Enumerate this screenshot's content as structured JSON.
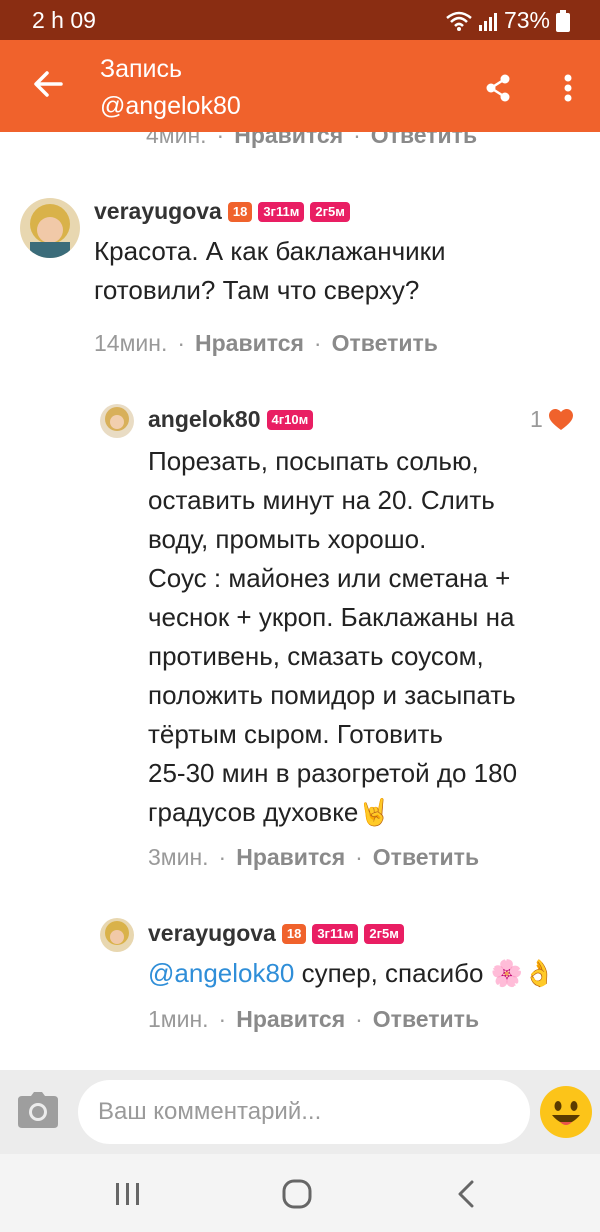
{
  "status_bar": {
    "time": "2 h 09",
    "battery": "73%"
  },
  "app_bar": {
    "title": "Запись",
    "subtitle": "@angelok80"
  },
  "comments": [
    {
      "partial": true,
      "time": "4мин.",
      "like_label": "Нравится",
      "reply_label": "Ответить"
    },
    {
      "username": "verayugova",
      "badges": [
        "18",
        "3г11м",
        "2г5м"
      ],
      "text": "Красота. А как баклажанчики готовили? Там что сверху?",
      "time": "14мин.",
      "like_label": "Нравится",
      "reply_label": "Ответить"
    },
    {
      "username": "angelok80",
      "badges": [
        "4г10м"
      ],
      "like_count": "1",
      "text_lines": [
        "Порезать, посыпать солью,",
        "оставить минут на 20. Слить",
        "воду, промыть хорошо.",
        "Соус : майонез или сметана +",
        "чеснок + укроп. Баклажаны на",
        "противень, смазать соусом,",
        "положить помидор и засыпать",
        "тёртым сыром. Готовить",
        "25-30 мин в разогретой до 180",
        "градусов духовке🤘"
      ],
      "time": "3мин.",
      "like_label": "Нравится",
      "reply_label": "Ответить"
    },
    {
      "username": "verayugova",
      "badges": [
        "18",
        "3г11м",
        "2г5м"
      ],
      "mention": "@angelok80",
      "text": " супер, спасибо 🌸👌",
      "time": "1мин.",
      "like_label": "Нравится",
      "reply_label": "Ответить"
    }
  ],
  "input": {
    "placeholder": "Ваш комментарий..."
  },
  "colors": {
    "accent": "#f0622c",
    "status_bar": "#8a2d12",
    "badge_pink": "#e91e63",
    "mention": "#2f8ed8",
    "heart": "#f0622c"
  },
  "icons": [
    "back-arrow-icon",
    "share-icon",
    "more-vert-icon",
    "heart-icon",
    "camera-icon",
    "emoji-icon",
    "recents-icon",
    "home-icon",
    "back-icon",
    "wifi-icon",
    "signal-icon",
    "battery-icon"
  ]
}
